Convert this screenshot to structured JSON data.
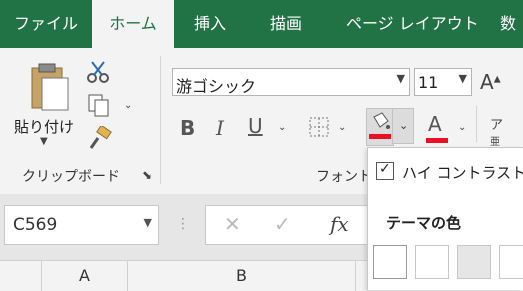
{
  "tabs": [
    "ファイル",
    "ホーム",
    "挿入",
    "描画",
    "ページ レイアウト",
    "数"
  ],
  "clipboard": {
    "paste_label": "貼り付け",
    "group_label": "クリップボード"
  },
  "font": {
    "name": "游ゴシック",
    "size": "11",
    "group_label": "フォント"
  },
  "name_box": "C569",
  "formula": {
    "fx_label": "fx"
  },
  "columns": [
    "A",
    "B"
  ],
  "dropdown": {
    "high_contrast_label": "ハイ コントラストの",
    "theme_colors_label": "テーマの色"
  },
  "colors": {
    "ribbon_green": "#217346",
    "fill_red": "#e81123",
    "font_red": "#e81123"
  }
}
